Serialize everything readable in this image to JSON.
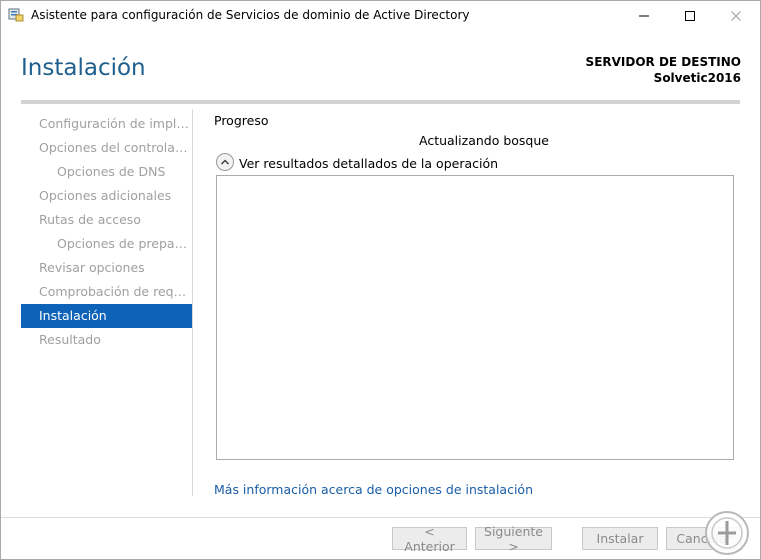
{
  "window": {
    "title": "Asistente para configuración de Servicios de dominio de Active Directory",
    "controls": {
      "minimize": "—",
      "maximize": "☐",
      "close": "✕"
    }
  },
  "header": {
    "page_title": "Instalación",
    "destination_label": "SERVIDOR DE DESTINO",
    "destination_server": "Solvetic2016"
  },
  "sidebar": {
    "items": [
      {
        "label": "Configuración de implem…",
        "sub": false,
        "active": false
      },
      {
        "label": "Opciones del controlador…",
        "sub": false,
        "active": false
      },
      {
        "label": "Opciones de DNS",
        "sub": true,
        "active": false
      },
      {
        "label": "Opciones adicionales",
        "sub": false,
        "active": false
      },
      {
        "label": "Rutas de acceso",
        "sub": false,
        "active": false
      },
      {
        "label": "Opciones de preparac…",
        "sub": true,
        "active": false
      },
      {
        "label": "Revisar opciones",
        "sub": false,
        "active": false
      },
      {
        "label": "Comprobación de requisi…",
        "sub": false,
        "active": false
      },
      {
        "label": "Instalación",
        "sub": false,
        "active": true
      },
      {
        "label": "Resultado",
        "sub": false,
        "active": false
      }
    ]
  },
  "main": {
    "progress_label": "Progreso",
    "status": "Actualizando bosque",
    "details_toggle_label": "Ver resultados detallados de la operación",
    "details_toggle_icon": "chevron-up-icon",
    "info_link": "Más información acerca de opciones de instalación"
  },
  "footer": {
    "previous": "< Anterior",
    "next": "Siguiente >",
    "install": "Instalar",
    "cancel": "Cancelar"
  },
  "colors": {
    "accent": "#0e63b8",
    "title_blue": "#1e5f8e",
    "link": "#1a5da8",
    "disabled_text": "#a0a0a0"
  }
}
